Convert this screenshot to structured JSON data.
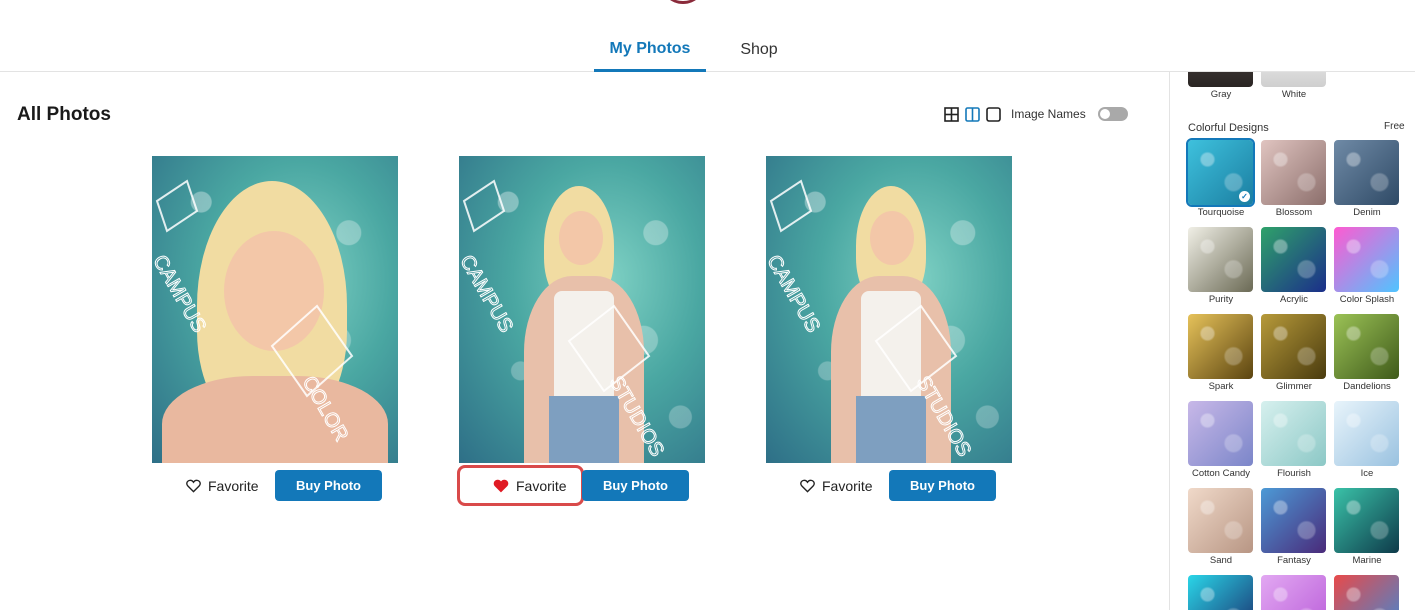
{
  "nav": {
    "tabs": [
      {
        "label": "My Photos",
        "active": true
      },
      {
        "label": "Shop",
        "active": false
      }
    ]
  },
  "main": {
    "title": "All Photos",
    "view_controls": {
      "image_names_label": "Image Names",
      "image_names_on": false,
      "active_view": "two-column"
    },
    "photos": [
      {
        "favorite_label": "Favorite",
        "favorited": false,
        "buy_label": "Buy Photo"
      },
      {
        "favorite_label": "Favorite",
        "favorited": true,
        "buy_label": "Buy Photo"
      },
      {
        "favorite_label": "Favorite",
        "favorited": false,
        "buy_label": "Buy Photo"
      }
    ],
    "watermark_text": [
      "CAMPUS",
      "COLOR",
      "STUDIOS"
    ]
  },
  "sidebar": {
    "top_backgrounds": [
      {
        "label": "Gray",
        "color": "#3a3533"
      },
      {
        "label": "White",
        "color": "#e8e8e8"
      }
    ],
    "section_title": "Colorful Designs",
    "section_price": "Free",
    "designs": [
      {
        "label": "Tourquoise",
        "colors": [
          "#3ec1dd",
          "#1b7ea1"
        ],
        "selected": true
      },
      {
        "label": "Blossom",
        "colors": [
          "#e0c4c0",
          "#8c6f6c"
        ],
        "selected": false
      },
      {
        "label": "Denim",
        "colors": [
          "#6f8aa6",
          "#2f4a66"
        ],
        "selected": false
      },
      {
        "label": "Purity",
        "colors": [
          "#f0efe6",
          "#6b6a55"
        ],
        "selected": false
      },
      {
        "label": "Acrylic",
        "colors": [
          "#2fa26a",
          "#1b2e8a"
        ],
        "selected": false
      },
      {
        "label": "Color Splash",
        "colors": [
          "#ff5ad1",
          "#4fc4ff"
        ],
        "selected": false
      },
      {
        "label": "Spark",
        "colors": [
          "#e6c25a",
          "#5b4410"
        ],
        "selected": false
      },
      {
        "label": "Glimmer",
        "colors": [
          "#b79a3a",
          "#4a3b0e"
        ],
        "selected": false
      },
      {
        "label": "Dandelions",
        "colors": [
          "#9bc256",
          "#3f5a1a"
        ],
        "selected": false
      },
      {
        "label": "Cotton Candy",
        "colors": [
          "#c8b8e8",
          "#7b86c9"
        ],
        "selected": false
      },
      {
        "label": "Flourish",
        "colors": [
          "#d6f0ee",
          "#8cc8c6"
        ],
        "selected": false
      },
      {
        "label": "Ice",
        "colors": [
          "#e8f4fb",
          "#9ac2e0"
        ],
        "selected": false
      },
      {
        "label": "Sand",
        "colors": [
          "#f0d9c9",
          "#b89684"
        ],
        "selected": false
      },
      {
        "label": "Fantasy",
        "colors": [
          "#4c9ad6",
          "#4a2a7a"
        ],
        "selected": false
      },
      {
        "label": "Marine",
        "colors": [
          "#3ac2a8",
          "#0e3a4a"
        ],
        "selected": false
      },
      {
        "label": "",
        "colors": [
          "#2ad6e8",
          "#1a2a6a"
        ],
        "selected": false
      },
      {
        "label": "",
        "colors": [
          "#e2a8f2",
          "#b85ad8"
        ],
        "selected": false
      },
      {
        "label": "",
        "colors": [
          "#e84a4a",
          "#3a8ad8"
        ],
        "selected": false
      }
    ]
  }
}
